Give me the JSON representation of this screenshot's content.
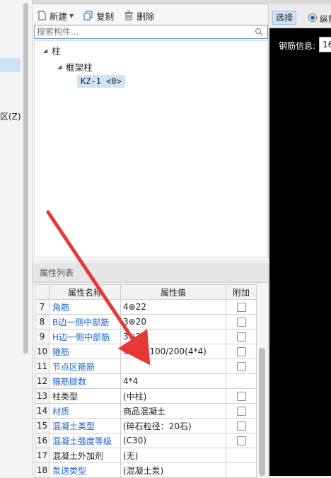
{
  "sidebar": {
    "z_label": "区(Z)"
  },
  "toolbar": {
    "new_label": "新建",
    "copy_label": "复制",
    "delete_label": "删除"
  },
  "search": {
    "placeholder": "搜索构件..."
  },
  "tree": {
    "root": "柱",
    "child": "框架柱",
    "leaf": "KZ-1 <0>"
  },
  "properties": {
    "header": "属性列表",
    "columns": [
      "属性名称",
      "属性值",
      "附加"
    ],
    "rows": [
      {
        "num": "7",
        "name": "角筋",
        "value": "4⊕22",
        "blue": true,
        "checkbox": true
      },
      {
        "num": "8",
        "name": "B边一侧中部筋",
        "value": "3⊕20",
        "blue": true,
        "checkbox": true
      },
      {
        "num": "9",
        "name": "H边一侧中部筋",
        "value": "3⊕20",
        "blue": true,
        "checkbox": true
      },
      {
        "num": "10",
        "name": "箍筋",
        "value": "⊕10@100/200(4*4)",
        "blue": true,
        "checkbox": true
      },
      {
        "num": "11",
        "name": "节点区箍筋",
        "value": "",
        "blue": true,
        "checkbox": true
      },
      {
        "num": "12",
        "name": "箍筋肢数",
        "value": "4*4",
        "blue": true,
        "checkbox": false
      },
      {
        "num": "13",
        "name": "柱类型",
        "value": "(中柱)",
        "blue": false,
        "checkbox": true
      },
      {
        "num": "14",
        "name": "材质",
        "value": "商品混凝土",
        "blue": true,
        "checkbox": true
      },
      {
        "num": "15",
        "name": "混凝土类型",
        "value": "(碎石粒径：20石)",
        "blue": true,
        "checkbox": true
      },
      {
        "num": "16",
        "name": "混凝土强度等级",
        "value": "(C30)",
        "blue": true,
        "checkbox": true
      },
      {
        "num": "17",
        "name": "混凝土外加剂",
        "value": "(无)",
        "blue": false,
        "checkbox": false
      },
      {
        "num": "18",
        "name": "泵送类型",
        "value": "(混凝土泵)",
        "blue": true,
        "checkbox": false
      }
    ]
  },
  "right_panel": {
    "select_label": "选择",
    "radio_label": "纵筋",
    "rebar_label": "钢筋信息:",
    "rebar_value": "16"
  },
  "colors": {
    "accent_blue": "#1a64c8",
    "arrow_red": "#e53935",
    "selection": "#cde4f7"
  }
}
